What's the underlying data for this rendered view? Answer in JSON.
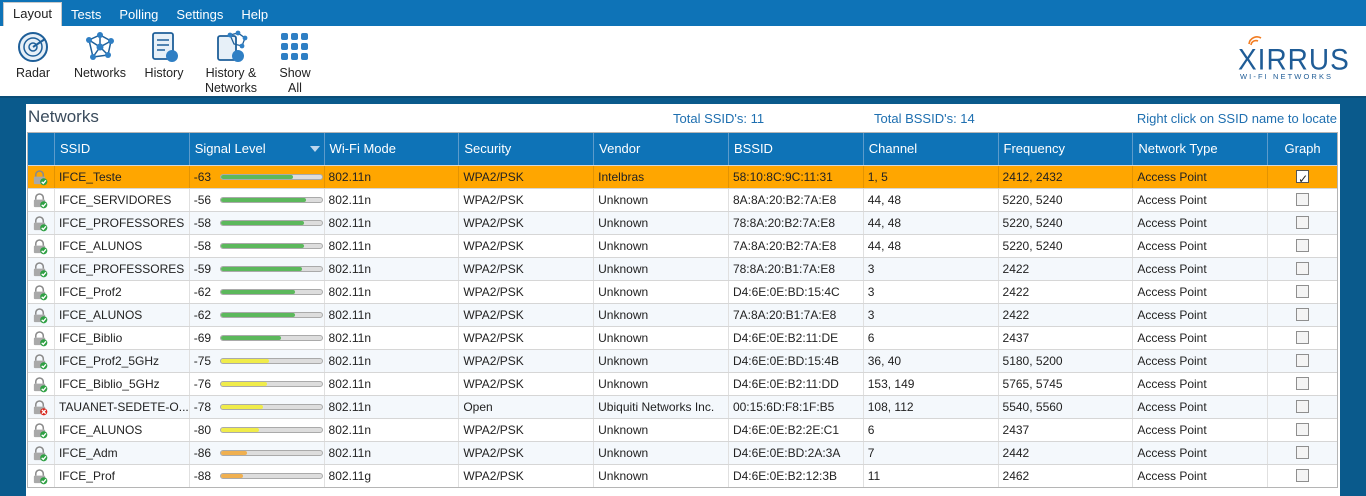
{
  "menu": [
    "Layout",
    "Tests",
    "Polling",
    "Settings",
    "Help"
  ],
  "ribbon": [
    {
      "label": "Radar",
      "icon": "radar-icon"
    },
    {
      "label": "Networks",
      "icon": "networks-icon"
    },
    {
      "label": "History",
      "icon": "history-icon"
    },
    {
      "label": "History &\nNetworks",
      "icon": "history-networks-icon"
    },
    {
      "label": "Show\nAll",
      "icon": "show-all-icon"
    }
  ],
  "logo": {
    "word": "XIRRUS",
    "sub": "WI-FI NETWORKS"
  },
  "panel": {
    "title": "Networks",
    "total_ssids": "Total SSID's: 11",
    "total_bssids": "Total BSSID's:  14",
    "hint": "Right click on SSID name to locate"
  },
  "columns": [
    "SSID",
    "Signal Level",
    "Wi-Fi Mode",
    "Security",
    "Vendor",
    "BSSID",
    "Channel",
    "Frequency",
    "Network Type",
    "Graph"
  ],
  "colors": {
    "good": "#5cb85c",
    "fair": "#f0ec4a",
    "weak": "#f0b050",
    "selected": "#ffa600",
    "header": "#0e73b7"
  },
  "rows": [
    {
      "ssid": "IFCE_Teste",
      "signal": "-63",
      "level": 0.72,
      "tier": "good",
      "mode": "802.11n",
      "security": "WPA2/PSK",
      "vendor": "Intelbras",
      "bssid": "58:10:8C:9C:11:31",
      "channel": "1, 5",
      "frequency": "2412, 2432",
      "type": "Access Point",
      "graph": true,
      "selected": true,
      "lock": "green"
    },
    {
      "ssid": "IFCE_SERVIDORES",
      "signal": "-56",
      "level": 0.84,
      "tier": "good",
      "mode": "802.11n",
      "security": "WPA2/PSK",
      "vendor": "Unknown",
      "bssid": "8A:8A:20:B2:7A:E8",
      "channel": "44, 48",
      "frequency": "5220, 5240",
      "type": "Access Point",
      "graph": false,
      "selected": false,
      "lock": "green"
    },
    {
      "ssid": "IFCE_PROFESSORES",
      "signal": "-58",
      "level": 0.82,
      "tier": "good",
      "mode": "802.11n",
      "security": "WPA2/PSK",
      "vendor": "Unknown",
      "bssid": "78:8A:20:B2:7A:E8",
      "channel": "44, 48",
      "frequency": "5220, 5240",
      "type": "Access Point",
      "graph": false,
      "selected": false,
      "lock": "green"
    },
    {
      "ssid": "IFCE_ALUNOS",
      "signal": "-58",
      "level": 0.82,
      "tier": "good",
      "mode": "802.11n",
      "security": "WPA2/PSK",
      "vendor": "Unknown",
      "bssid": "7A:8A:20:B2:7A:E8",
      "channel": "44, 48",
      "frequency": "5220, 5240",
      "type": "Access Point",
      "graph": false,
      "selected": false,
      "lock": "green"
    },
    {
      "ssid": "IFCE_PROFESSORES",
      "signal": "-59",
      "level": 0.8,
      "tier": "good",
      "mode": "802.11n",
      "security": "WPA2/PSK",
      "vendor": "Unknown",
      "bssid": "78:8A:20:B1:7A:E8",
      "channel": "3",
      "frequency": "2422",
      "type": "Access Point",
      "graph": false,
      "selected": false,
      "lock": "green"
    },
    {
      "ssid": "IFCE_Prof2",
      "signal": "-62",
      "level": 0.74,
      "tier": "good",
      "mode": "802.11n",
      "security": "WPA2/PSK",
      "vendor": "Unknown",
      "bssid": "D4:6E:0E:BD:15:4C",
      "channel": "3",
      "frequency": "2422",
      "type": "Access Point",
      "graph": false,
      "selected": false,
      "lock": "green"
    },
    {
      "ssid": "IFCE_ALUNOS",
      "signal": "-62",
      "level": 0.74,
      "tier": "good",
      "mode": "802.11n",
      "security": "WPA2/PSK",
      "vendor": "Unknown",
      "bssid": "7A:8A:20:B1:7A:E8",
      "channel": "3",
      "frequency": "2422",
      "type": "Access Point",
      "graph": false,
      "selected": false,
      "lock": "green"
    },
    {
      "ssid": "IFCE_Biblio",
      "signal": "-69",
      "level": 0.6,
      "tier": "good",
      "mode": "802.11n",
      "security": "WPA2/PSK",
      "vendor": "Unknown",
      "bssid": "D4:6E:0E:B2:11:DE",
      "channel": "6",
      "frequency": "2437",
      "type": "Access Point",
      "graph": false,
      "selected": false,
      "lock": "green"
    },
    {
      "ssid": "IFCE_Prof2_5GHz",
      "signal": "-75",
      "level": 0.48,
      "tier": "fair",
      "mode": "802.11n",
      "security": "WPA2/PSK",
      "vendor": "Unknown",
      "bssid": "D4:6E:0E:BD:15:4B",
      "channel": "36, 40",
      "frequency": "5180, 5200",
      "type": "Access Point",
      "graph": false,
      "selected": false,
      "lock": "green"
    },
    {
      "ssid": "IFCE_Biblio_5GHz",
      "signal": "-76",
      "level": 0.46,
      "tier": "fair",
      "mode": "802.11n",
      "security": "WPA2/PSK",
      "vendor": "Unknown",
      "bssid": "D4:6E:0E:B2:11:DD",
      "channel": "153, 149",
      "frequency": "5765, 5745",
      "type": "Access Point",
      "graph": false,
      "selected": false,
      "lock": "green"
    },
    {
      "ssid": "TAUANET-SEDETE-O...",
      "signal": "-78",
      "level": 0.42,
      "tier": "fair",
      "mode": "802.11n",
      "security": "Open",
      "vendor": "Ubiquiti Networks Inc.",
      "bssid": "00:15:6D:F8:1F:B5",
      "channel": "108, 112",
      "frequency": "5540, 5560",
      "type": "Access Point",
      "graph": false,
      "selected": false,
      "lock": "red"
    },
    {
      "ssid": "IFCE_ALUNOS",
      "signal": "-80",
      "level": 0.38,
      "tier": "fair",
      "mode": "802.11n",
      "security": "WPA2/PSK",
      "vendor": "Unknown",
      "bssid": "D4:6E:0E:B2:2E:C1",
      "channel": "6",
      "frequency": "2437",
      "type": "Access Point",
      "graph": false,
      "selected": false,
      "lock": "green"
    },
    {
      "ssid": "IFCE_Adm",
      "signal": "-86",
      "level": 0.26,
      "tier": "weak",
      "mode": "802.11n",
      "security": "WPA2/PSK",
      "vendor": "Unknown",
      "bssid": "D4:6E:0E:BD:2A:3A",
      "channel": "7",
      "frequency": "2442",
      "type": "Access Point",
      "graph": false,
      "selected": false,
      "lock": "green"
    },
    {
      "ssid": "IFCE_Prof",
      "signal": "-88",
      "level": 0.22,
      "tier": "weak",
      "mode": "802.11g",
      "security": "WPA2/PSK",
      "vendor": "Unknown",
      "bssid": "D4:6E:0E:B2:12:3B",
      "channel": "11",
      "frequency": "2462",
      "type": "Access Point",
      "graph": false,
      "selected": false,
      "lock": "green"
    }
  ]
}
